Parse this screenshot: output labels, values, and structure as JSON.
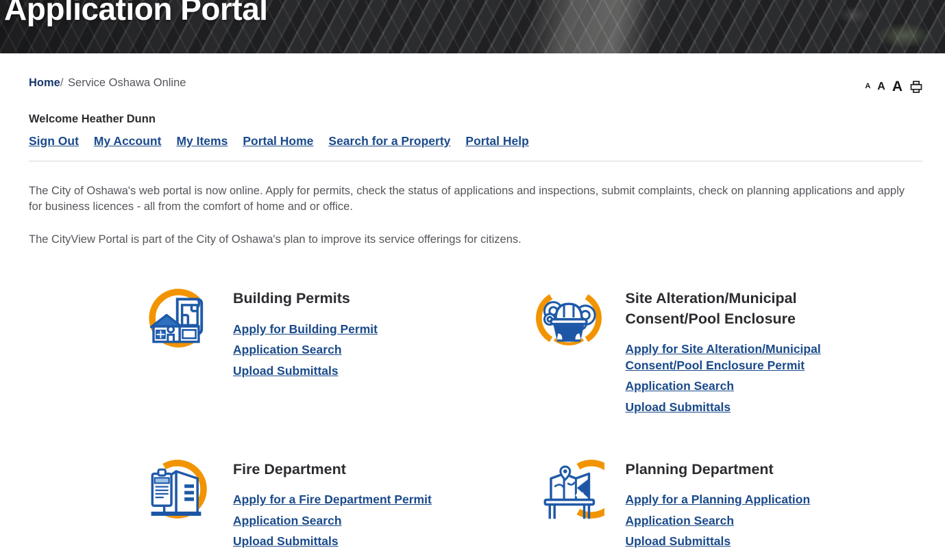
{
  "banner": {
    "title": "Application Portal",
    "image_description": "aerial-photo-residential-rooftops"
  },
  "breadcrumb": {
    "home_label": "Home",
    "separator": "/",
    "current_label": "Service Oshawa Online"
  },
  "tools": {
    "font_small_label": "A",
    "font_medium_label": "A",
    "font_large_label": "A",
    "print_icon": "printer-icon"
  },
  "account": {
    "welcome_text": "Welcome Heather Dunn",
    "nav_links": [
      {
        "label": "Sign Out",
        "name": "sign-out"
      },
      {
        "label": "My Account",
        "name": "my-account"
      },
      {
        "label": "My Items",
        "name": "my-items"
      },
      {
        "label": "Portal Home",
        "name": "portal-home"
      },
      {
        "label": "Search for a Property",
        "name": "search-for-a-property"
      },
      {
        "label": "Portal Help",
        "name": "portal-help"
      }
    ]
  },
  "intro": {
    "paragraph_1": "The City of Oshawa's web portal is now online. Apply for permits, check the status of applications and inspections, submit complaints, check on planning applications and apply for business licences - all from the comfort of home and or office.",
    "paragraph_2": "The CityView Portal is part of the City of Oshawa's plan to improve its service offerings for citizens."
  },
  "services": [
    {
      "title": "Building Permits",
      "icon": "house-blueprint-icon",
      "links": [
        "Apply for Building Permit",
        "Application Search",
        "Upload Submittals"
      ]
    },
    {
      "title": "Site Alteration/Municipal Consent/Pool Enclosure",
      "icon": "hardhat-gears-icon",
      "links": [
        "Apply for Site Alteration/Municipal Consent/Pool Enclosure Permit",
        "Application Search",
        "Upload Submittals"
      ]
    },
    {
      "title": "Fire Department",
      "icon": "clipboard-buildings-icon",
      "links": [
        "Apply for a Fire Department Permit",
        "Application Search",
        "Upload Submittals"
      ]
    },
    {
      "title": "Planning Department",
      "icon": "desk-map-pin-icon",
      "links": [
        "Apply for a Planning Application",
        "Application Search",
        "Upload Submittals"
      ]
    }
  ],
  "colors": {
    "link_blue": "#1a4a8a",
    "breadcrumb_blue": "#18376b",
    "icon_blue": "#1f5aa8",
    "icon_orange": "#f29400",
    "heading_dark": "#2c2c30",
    "body_text": "#55565c"
  }
}
